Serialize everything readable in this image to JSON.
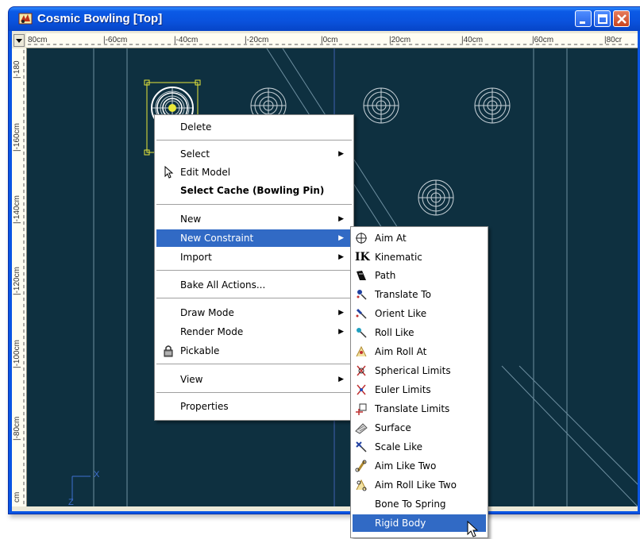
{
  "window": {
    "title": "Cosmic Bowling [Top]"
  },
  "ruler": {
    "h_ticks": [
      "80cm",
      "|-60cm",
      "|-40cm",
      "|-20cm",
      "|0cm",
      "|20cm",
      "|40cm",
      "|60cm",
      "|80cr"
    ],
    "v_ticks": [
      "|-180",
      "|-160cm",
      "|-140cm",
      "|-120cm",
      "|-100cm",
      "|-80cm",
      "cm"
    ]
  },
  "viewport": {
    "axis_x_label": "X",
    "axis_z_label": "Z",
    "background": "#0e3040",
    "selection_color": "#e8e83a"
  },
  "context_menu": {
    "items": [
      {
        "label": "Delete"
      },
      {
        "label": "Select"
      },
      {
        "label": "Edit Model",
        "icon": "cursor-arrow-icon"
      },
      {
        "label": "Select Cache (Bowling Pin)"
      },
      {
        "label": "New"
      },
      {
        "label": "New Constraint",
        "highlighted": true
      },
      {
        "label": "Import"
      },
      {
        "label": "Bake All Actions..."
      },
      {
        "label": "Draw Mode"
      },
      {
        "label": "Render Mode"
      },
      {
        "label": "Pickable",
        "icon": "lock-icon"
      },
      {
        "label": "View"
      },
      {
        "label": "Properties"
      }
    ]
  },
  "constraint_menu": {
    "items": [
      {
        "label": "Aim At",
        "icon": "crosshair-icon"
      },
      {
        "label": "Kinematic",
        "icon": "ik-icon"
      },
      {
        "label": "Path",
        "icon": "path-icon"
      },
      {
        "label": "Translate To",
        "icon": "translate-to-icon"
      },
      {
        "label": "Orient Like",
        "icon": "orient-like-icon"
      },
      {
        "label": "Roll Like",
        "icon": "roll-like-icon"
      },
      {
        "label": "Aim Roll At",
        "icon": "aim-roll-at-icon"
      },
      {
        "label": "Spherical Limits",
        "icon": "spherical-limits-icon"
      },
      {
        "label": "Euler Limits",
        "icon": "euler-limits-icon"
      },
      {
        "label": "Translate Limits",
        "icon": "translate-limits-icon"
      },
      {
        "label": "Surface",
        "icon": "surface-icon"
      },
      {
        "label": "Scale Like",
        "icon": "scale-like-icon"
      },
      {
        "label": "Aim Like Two",
        "icon": "aim-like-two-icon"
      },
      {
        "label": "Aim Roll Like Two",
        "icon": "aim-roll-like-two-icon"
      },
      {
        "label": "Bone To Spring"
      },
      {
        "label": "Rigid Body",
        "highlighted": true
      }
    ]
  },
  "colors": {
    "highlight": "#316ac5",
    "titlebar": "#0a55e3"
  }
}
